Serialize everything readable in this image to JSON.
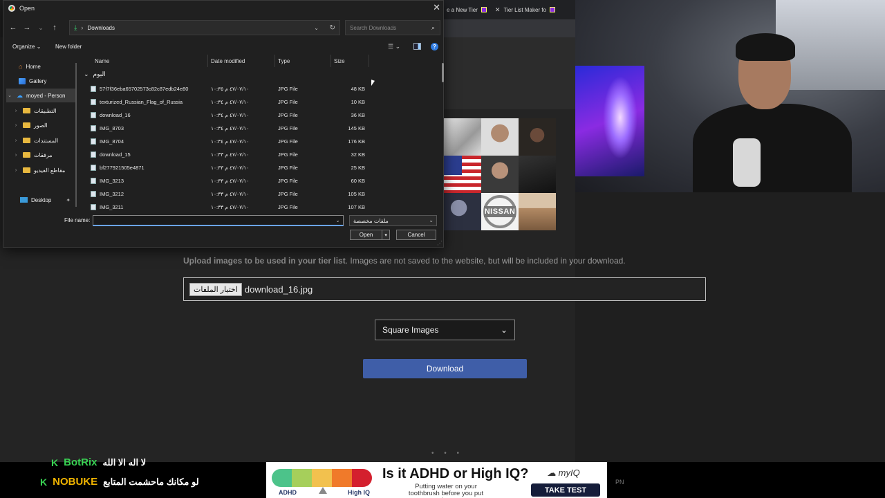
{
  "browser": {
    "tabs": [
      {
        "label": "e a New Tier"
      },
      {
        "label": "Tier List Maker fo"
      }
    ]
  },
  "page": {
    "upload_note_bold": "Upload images to be used in your tier list",
    "upload_note_rest": ". Images are not saved to the website, but will be included in your download.",
    "file_button": "اختيار الملفات",
    "file_chosen": "download_16.jpg",
    "image_mode": "Square Images",
    "download_button": "Download",
    "thumbnail_logo": "NISSAN",
    "dots": "• • •"
  },
  "dialog": {
    "title": "Open",
    "path": "Downloads",
    "search_placeholder": "Search Downloads",
    "organize": "Organize",
    "new_folder": "New folder",
    "help": "?",
    "nav": [
      {
        "label": "Home",
        "icon": "home-icon"
      },
      {
        "label": "Gallery",
        "icon": "gallery-icon"
      },
      {
        "label": "moyed - Person",
        "icon": "cloud-icon"
      },
      {
        "label": "التطبيقات",
        "icon": "folder-icon"
      },
      {
        "label": "الصور",
        "icon": "folder-icon"
      },
      {
        "label": "المستندات",
        "icon": "folder-icon"
      },
      {
        "label": "مرفقات",
        "icon": "folder-icon"
      },
      {
        "label": "مقاطع الفيديو",
        "icon": "folder-icon"
      },
      {
        "label": "Desktop",
        "icon": "desktop-icon"
      }
    ],
    "columns": {
      "name": "Name",
      "date": "Date modified",
      "type": "Type",
      "size": "Size"
    },
    "group": "اليوم",
    "files": [
      {
        "name": "57f7f36eba65702573c82c87edb24e80",
        "date": "٤٧/٠٧/١٠ م ١٠:٣٥",
        "type": "JPG File",
        "size": "48 KB"
      },
      {
        "name": "texturized_Russian_Flag_of_Russia",
        "date": "٤٧/٠٧/١٠ م ١٠:٣٤",
        "type": "JPG File",
        "size": "10 KB"
      },
      {
        "name": "download_16",
        "date": "٤٧/٠٧/١٠ م ١٠:٣٤",
        "type": "JPG File",
        "size": "36 KB"
      },
      {
        "name": "IMG_8703",
        "date": "٤٧/٠٧/١٠ م ١٠:٣٤",
        "type": "JPG File",
        "size": "145 KB"
      },
      {
        "name": "IMG_8704",
        "date": "٤٧/٠٧/١٠ م ١٠:٣٤",
        "type": "JPG File",
        "size": "176 KB"
      },
      {
        "name": "download_15",
        "date": "٤٧/٠٧/١٠ م ١٠:٣٣",
        "type": "JPG File",
        "size": "32 KB"
      },
      {
        "name": "bf277921505e4871",
        "date": "٤٧/٠٧/١٠ م ١٠:٣٣",
        "type": "JPG File",
        "size": "25 KB"
      },
      {
        "name": "IMG_3213",
        "date": "٤٧/٠٧/١٠ م ١٠:٣٣",
        "type": "JPG File",
        "size": "60 KB"
      },
      {
        "name": "IMG_3212",
        "date": "٤٧/٠٧/١٠ م ١٠:٣٣",
        "type": "JPG File",
        "size": "105 KB"
      },
      {
        "name": "IMG_3211",
        "date": "٤٧/٠٧/١٠ م ١٠:٣٣",
        "type": "JPG File",
        "size": "107 KB"
      }
    ],
    "file_name_label": "File name:",
    "file_name_value": "",
    "file_type": "ملفات مخصصة",
    "open_button": "Open",
    "cancel_button": "Cancel"
  },
  "stream": {
    "chat": [
      {
        "user": "BotRix",
        "message": "لا اله الا الله"
      },
      {
        "user": "NOBUKE",
        "message": "لو مكانك ماحشمت المتابع"
      }
    ],
    "ad": {
      "label_left": "ADHD",
      "label_right": "High IQ",
      "headline": "Is it ADHD or High IQ?",
      "subtext": "Putting water on your toothbrush before you put toothpaste",
      "brand": "myIQ",
      "cta": "TAKE TEST",
      "scale_colors": [
        "#4cc38a",
        "#a6cf5b",
        "#f2c14e",
        "#f07a2a",
        "#d4202e"
      ]
    },
    "corner_text": "PN"
  }
}
